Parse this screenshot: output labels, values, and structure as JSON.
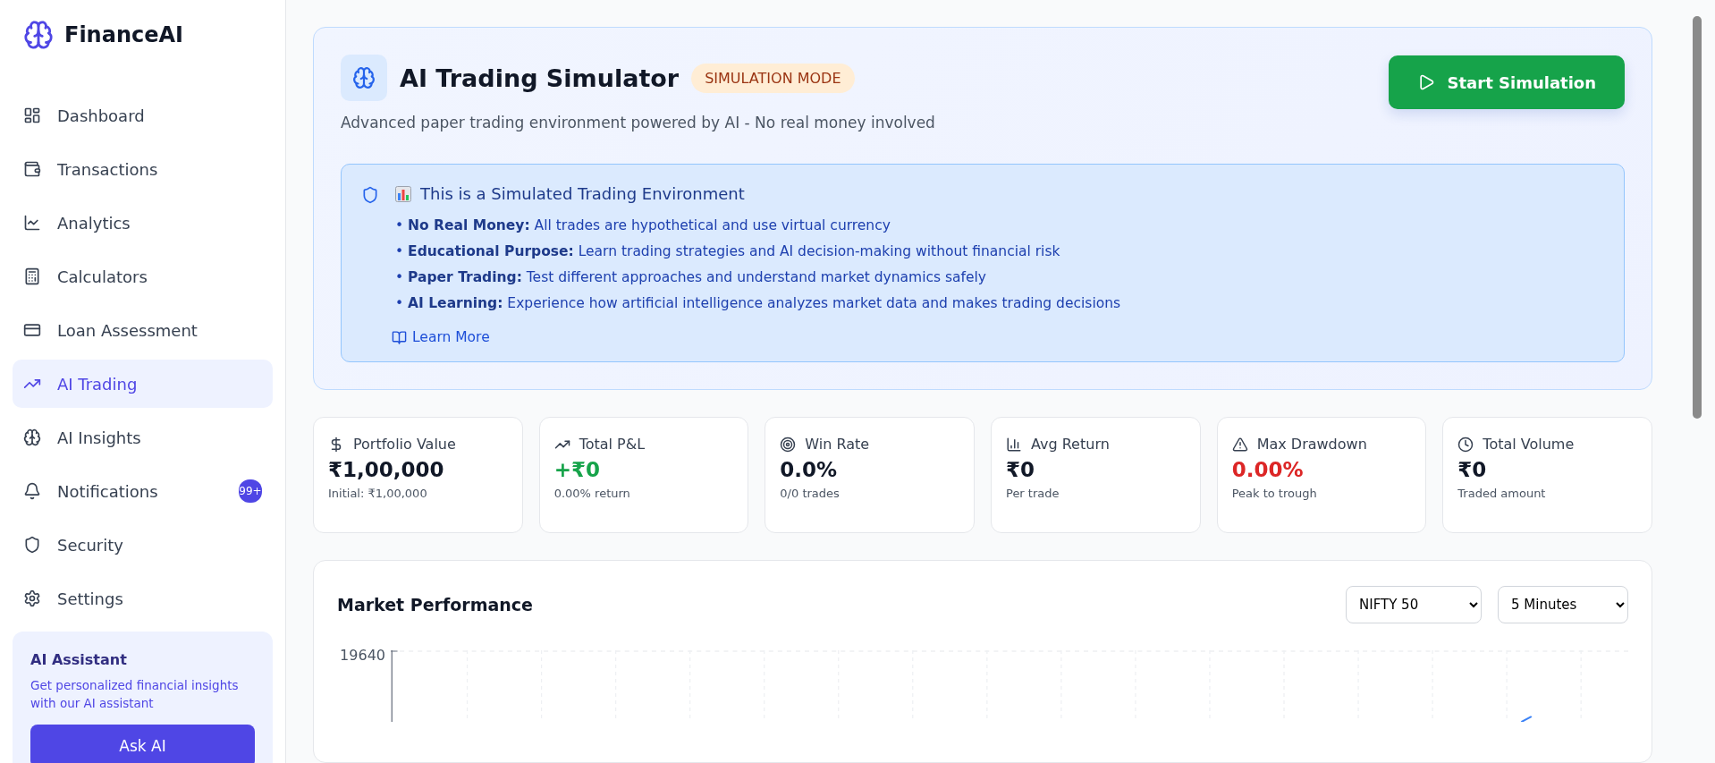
{
  "sidebar": {
    "brand": "FinanceAI",
    "items": [
      {
        "label": "Dashboard",
        "selected": false
      },
      {
        "label": "Transactions",
        "selected": false
      },
      {
        "label": "Analytics",
        "selected": false
      },
      {
        "label": "Calculators",
        "selected": false
      },
      {
        "label": "Loan Assessment",
        "selected": false
      },
      {
        "label": "AI Trading",
        "selected": true
      },
      {
        "label": "AI Insights",
        "selected": false
      },
      {
        "label": "Notifications",
        "selected": false,
        "badge": "99+"
      },
      {
        "label": "Security",
        "selected": false
      },
      {
        "label": "Settings",
        "selected": false
      }
    ],
    "assistant": {
      "title": "AI Assistant",
      "text": "Get personalized financial insights with our AI assistant",
      "button": "Ask AI"
    }
  },
  "header": {
    "title": "AI Trading Simulator",
    "badge": "SIMULATION MODE",
    "subtitle": "Advanced paper trading environment powered by AI - No real money involved",
    "button": "Start Simulation",
    "notice": {
      "title": "This is a Simulated Trading Environment",
      "bullets": [
        "• **No Real Money:** All trades are hypothetical and use virtual currency",
        "• **Educational Purpose:** Learn trading strategies and AI decision-making without financial risk",
        "• **Paper Trading:** Test different approaches and understand market dynamics safely",
        "• **AI Learning:** Experience how artificial intelligence analyzes market data and makes trading decisions"
      ],
      "link": "Learn More"
    }
  },
  "stats": [
    {
      "label": "Portfolio Value",
      "value": "₹1,00,000",
      "note": "Initial: ₹1,00,000",
      "color": "#111827"
    },
    {
      "label": "Total P&L",
      "value": "+₹0",
      "note": "0.00% return",
      "color": "#16a34a"
    },
    {
      "label": "Win Rate",
      "value": "0.0%",
      "note": "0/0 trades",
      "color": "#111827"
    },
    {
      "label": "Avg Return",
      "value": "₹0",
      "note": "Per trade",
      "color": "#111827"
    },
    {
      "label": "Max Drawdown",
      "value": "0.00%",
      "note": "Peak to trough",
      "color": "#dc2626"
    },
    {
      "label": "Total Volume",
      "value": "₹0",
      "note": "Traded amount",
      "color": "#111827"
    }
  ],
  "chart": {
    "title": "Market Performance",
    "index_select": "NIFTY 50",
    "interval_select": "5 Minutes",
    "y_tick": "19640"
  }
}
